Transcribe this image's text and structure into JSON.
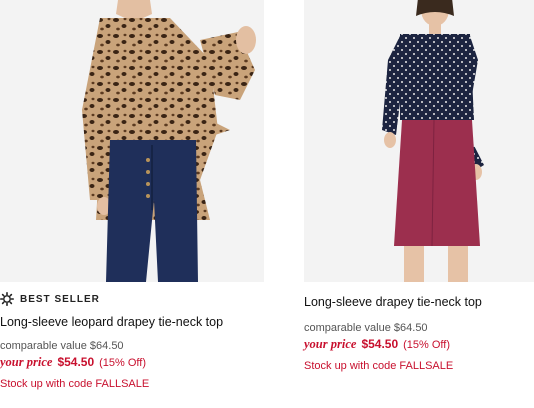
{
  "products": [
    {
      "badge": "BEST SELLER",
      "badge_icon": "sparkle-badge-icon",
      "title": "Long-sleeve leopard drapey tie-neck top",
      "comparable_label": "comparable value",
      "comparable_value": "$64.50",
      "your_price_label": "your price",
      "price": "$54.50",
      "discount": "(15% Off)",
      "promo": "Stock up with code FALLSALE"
    },
    {
      "title": "Long-sleeve drapey tie-neck top",
      "comparable_label": "comparable value",
      "comparable_value": "$64.50",
      "your_price_label": "your price",
      "price": "$54.50",
      "discount": "(15% Off)",
      "promo": "Stock up with code FALLSALE"
    }
  ],
  "colors": {
    "sale_red": "#c8102e",
    "background": "#ffffff",
    "photo_bg": "#f3f3f3"
  }
}
